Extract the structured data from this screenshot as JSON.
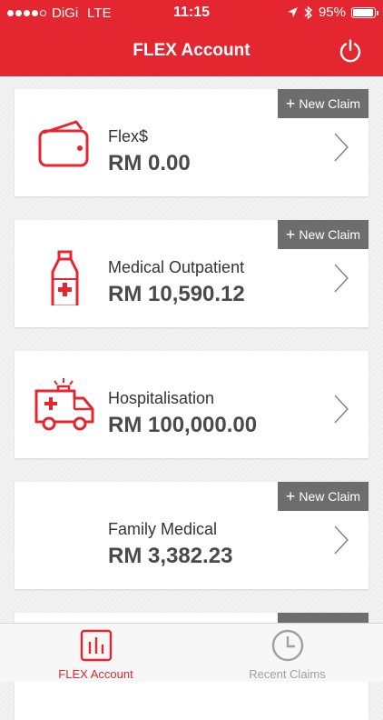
{
  "status_bar": {
    "carrier": "DiGi",
    "network": "LTE",
    "time": "11:15",
    "battery": "95%",
    "battery_level": 0.95
  },
  "header": {
    "title": "FLEX Account"
  },
  "colors": {
    "brand_red": "#e3262f",
    "badge_gray": "#6d6d6d"
  },
  "cards": [
    {
      "label": "Flex$",
      "amount": "RM 0.00",
      "new_claim": "New Claim",
      "icon": "wallet-icon"
    },
    {
      "label": "Medical Outpatient",
      "amount": "RM 10,590.12",
      "new_claim": "New Claim",
      "icon": "medicine-bottle-icon"
    },
    {
      "label": "Hospitalisation",
      "amount": "RM 100,000.00",
      "icon": "ambulance-icon"
    },
    {
      "label": "Family Medical",
      "amount": "RM 3,382.23",
      "new_claim": "New Claim",
      "icon": "family-icon"
    }
  ],
  "tabbar": [
    {
      "label": "FLEX Account",
      "icon": "bar-chart-icon",
      "active": true
    },
    {
      "label": "Recent Claims",
      "icon": "clock-icon",
      "active": false
    }
  ]
}
